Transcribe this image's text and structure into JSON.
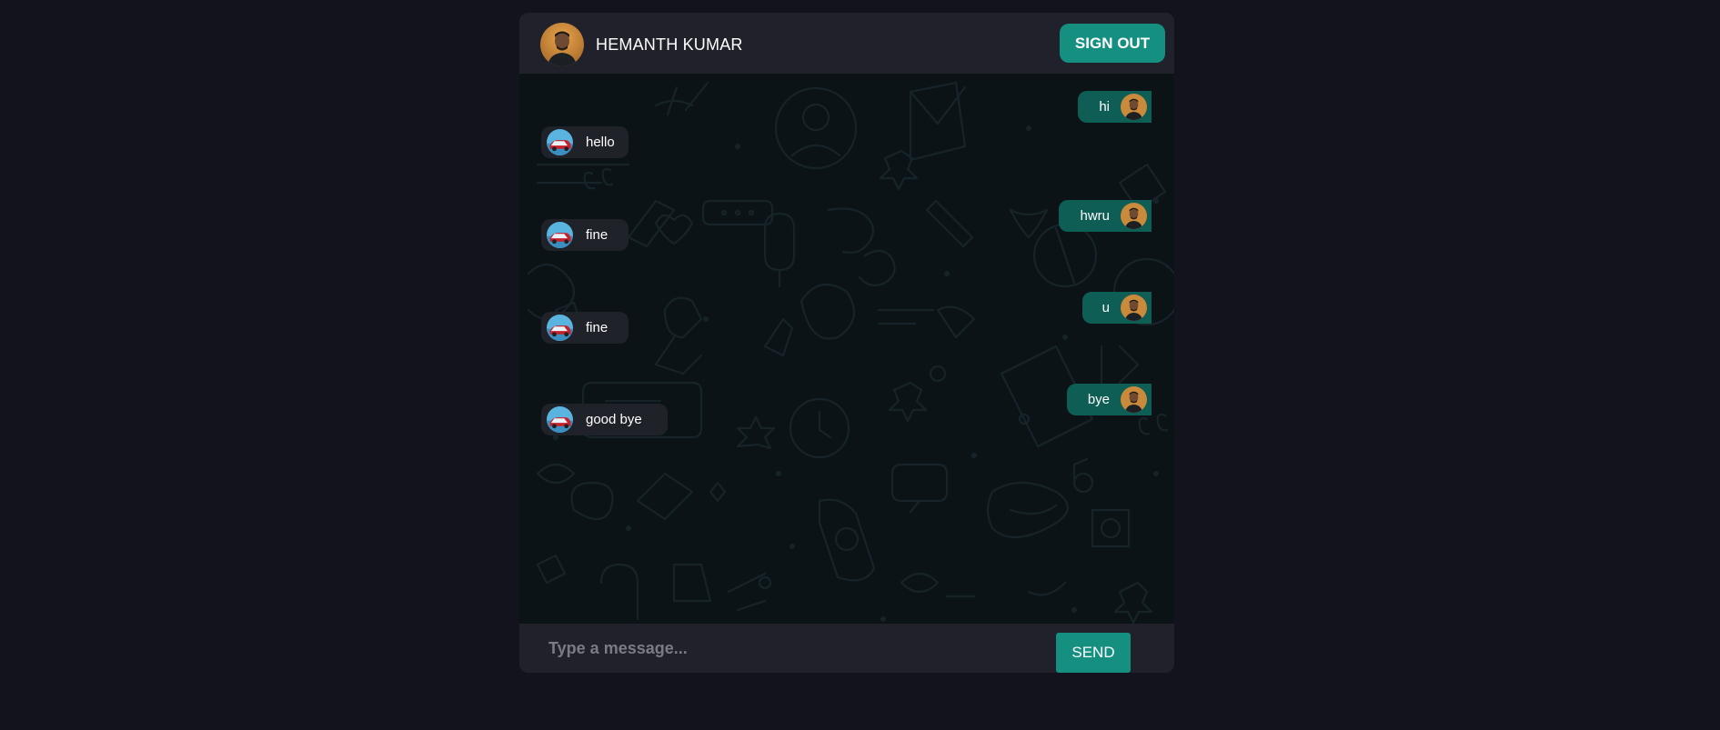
{
  "header": {
    "user_name": "HEMANTH KUMAR",
    "signout_label": "SIGN OUT",
    "avatar_icon": "user-avatar-icon"
  },
  "messages": [
    {
      "direction": "sent",
      "text": "hi"
    },
    {
      "direction": "received",
      "text": "hello"
    },
    {
      "direction": "sent",
      "text": "hwru"
    },
    {
      "direction": "received",
      "text": "fine"
    },
    {
      "direction": "sent",
      "text": "u"
    },
    {
      "direction": "received",
      "text": "fine"
    },
    {
      "direction": "sent",
      "text": "bye"
    },
    {
      "direction": "received",
      "text": "good bye"
    }
  ],
  "composer": {
    "placeholder": "Type a message...",
    "value": "",
    "send_label": "SEND"
  },
  "colors": {
    "page_background": "#13131e",
    "panel": "#21212c",
    "accent": "#148f80",
    "sent_bubble": "#0e5e55",
    "received_bubble": "#20222a",
    "chat_background": "#0b1317"
  }
}
